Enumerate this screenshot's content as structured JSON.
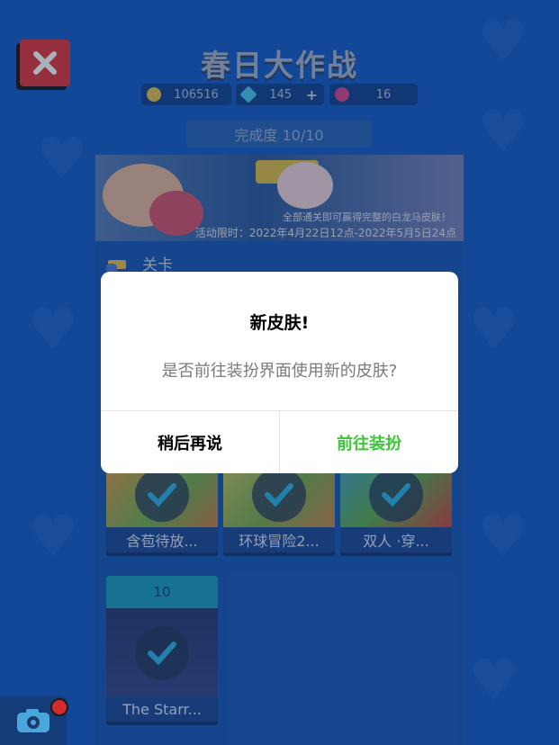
{
  "header": {
    "title": "春日大作战",
    "close_icon": "close-icon"
  },
  "currencies": [
    {
      "name": "coins",
      "icon": "coin-icon",
      "value": "106516",
      "color": "#e6c34a"
    },
    {
      "name": "diamonds",
      "icon": "diamond-icon",
      "value": "145",
      "color": "#4ec9e8",
      "plus": "+"
    },
    {
      "name": "tickets",
      "icon": "ticket-icon",
      "value": "16",
      "color": "#d84a8b"
    }
  ],
  "progress": {
    "label": "完成度 10/10"
  },
  "banner": {
    "line1": "全部通关即可赢得完整的白龙马皮肤！",
    "line2": "活动限时：2022年4月22日12点-2022年5月5日24点"
  },
  "levels": {
    "header": "关卡",
    "cards": [
      {
        "label": "含苞待放...",
        "completed": true
      },
      {
        "label": "环球冒险2...",
        "completed": true
      },
      {
        "label": "双人 ·穿...",
        "completed": true
      },
      {
        "number": "10",
        "label": "The Starr...",
        "completed": true
      }
    ]
  },
  "dialog": {
    "title": "新皮肤!",
    "message": "是否前往装扮界面使用新的皮肤?",
    "cancel_label": "稍后再说",
    "confirm_label": "前往装扮"
  },
  "colors": {
    "background": "#1a5ec4",
    "confirm": "#3ec63a",
    "close": "#e03a3a"
  }
}
